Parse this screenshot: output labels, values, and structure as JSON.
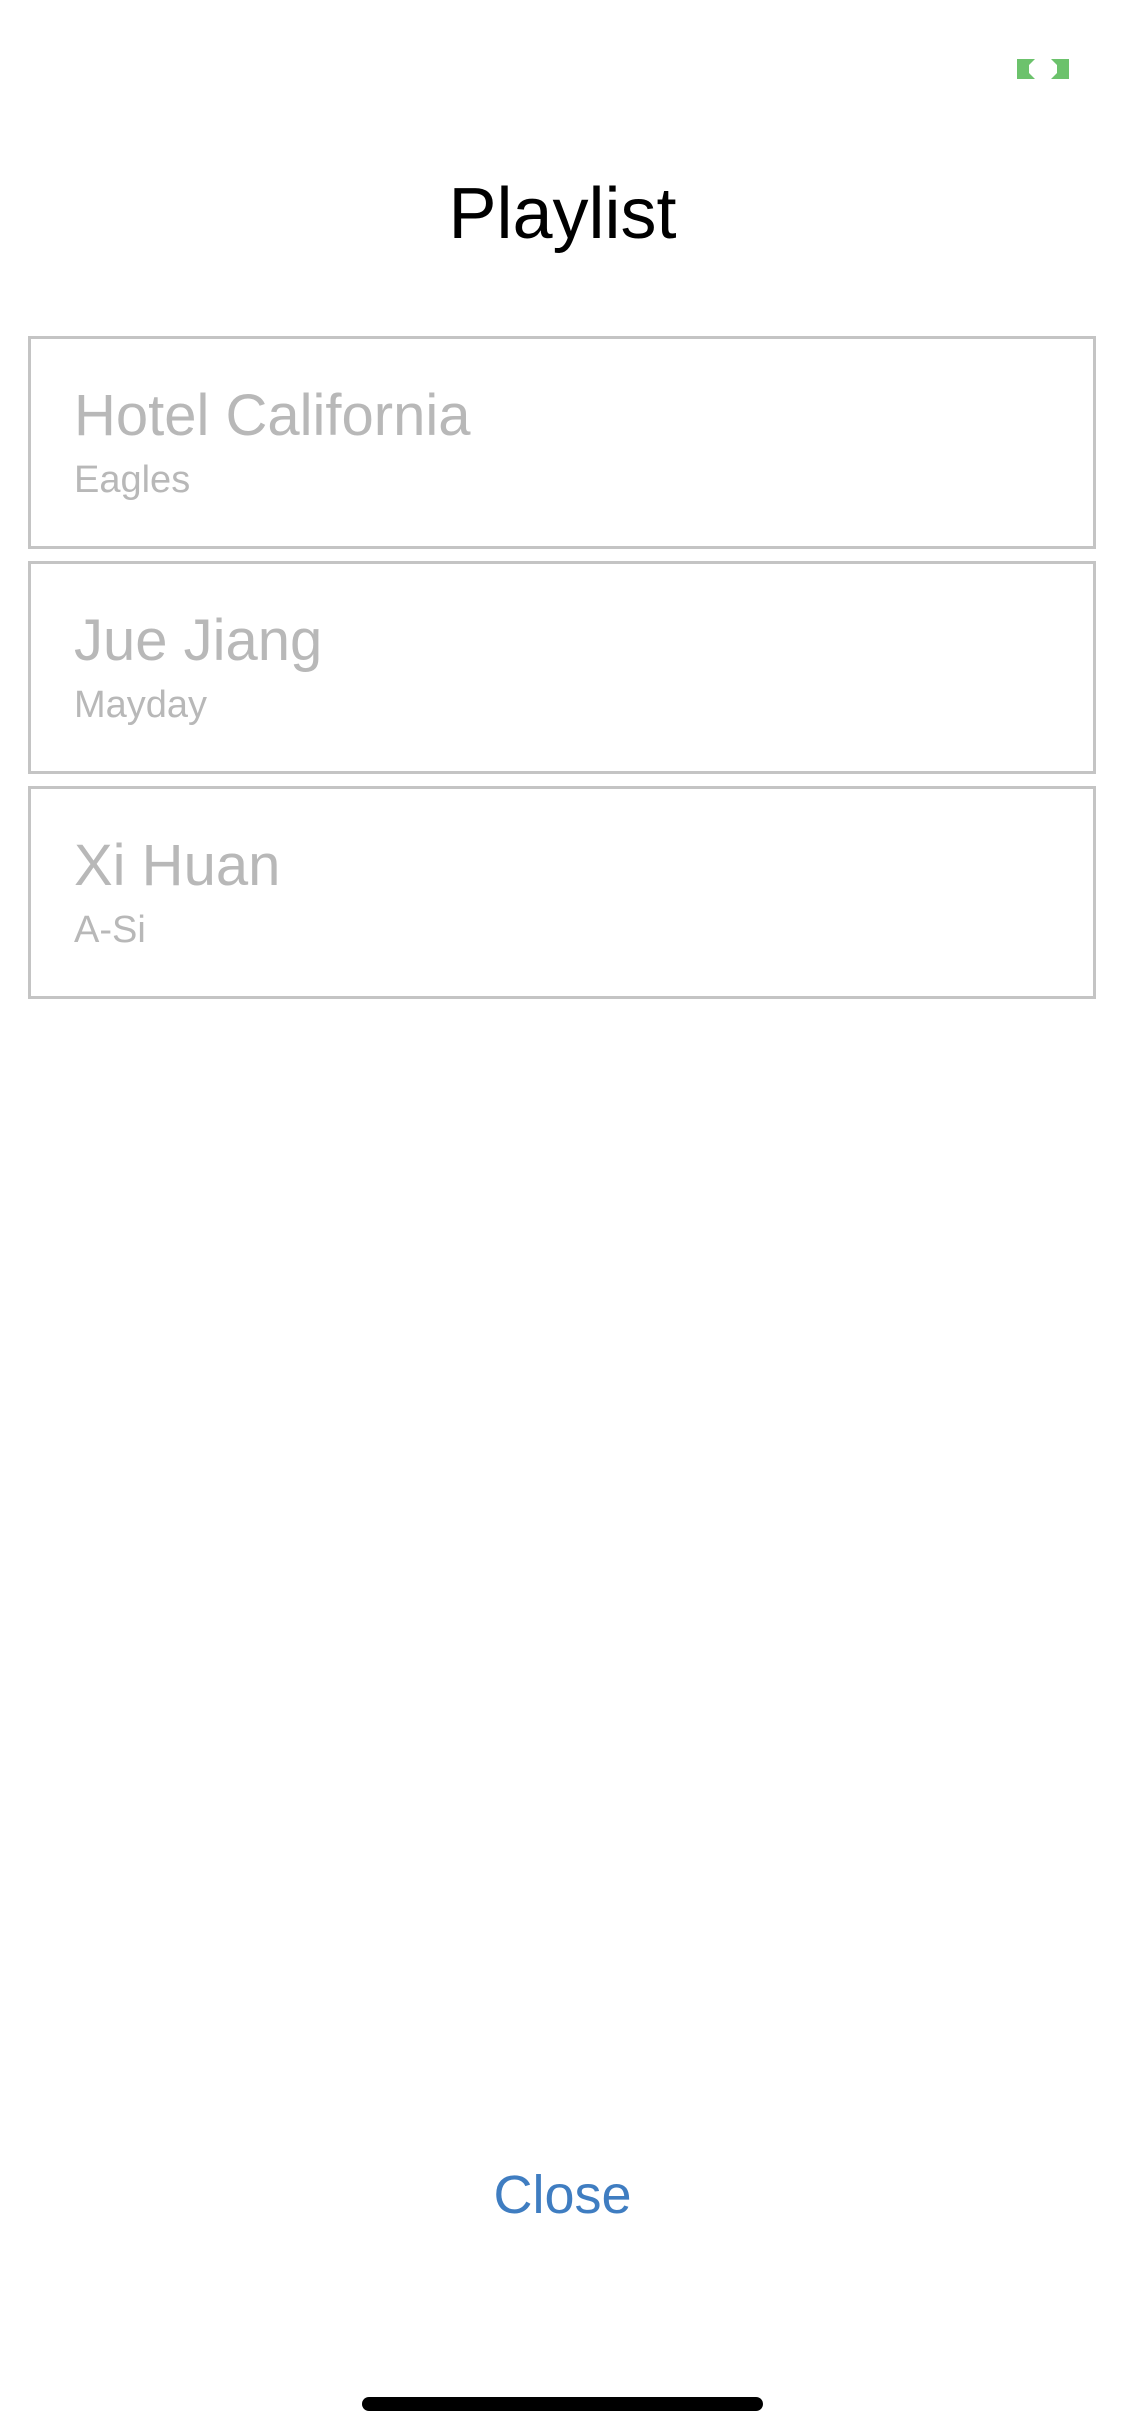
{
  "header": {
    "title": "Playlist"
  },
  "status": {
    "indicator_icon": "green-bracket-icon",
    "indicator_color": "#6cc26c"
  },
  "playlist": {
    "items": [
      {
        "title": "Hotel California",
        "artist": "Eagles"
      },
      {
        "title": "Jue Jiang",
        "artist": "Mayday"
      },
      {
        "title": "Xi Huan",
        "artist": "A-Si"
      }
    ]
  },
  "footer": {
    "close_label": "Close"
  },
  "colors": {
    "accent": "#3f7dc1",
    "muted_text": "#b8b8b8",
    "border": "#c4c4c4"
  }
}
